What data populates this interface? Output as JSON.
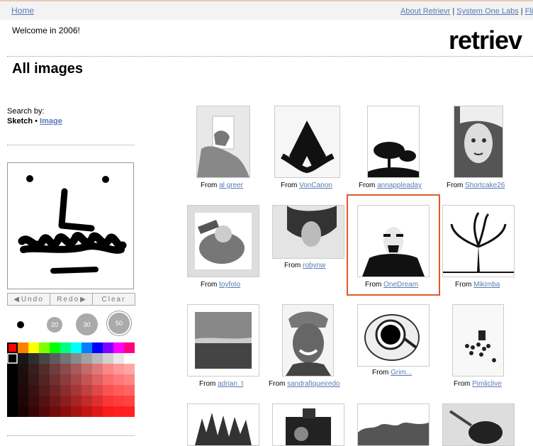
{
  "topbar": {
    "home": "Home",
    "about": "About Retrievr",
    "sep1": " | ",
    "system": "System One Labs",
    "sep2": " | ",
    "flickr": "Flic"
  },
  "welcome": "Welcome in 2006!",
  "logo": "retriev",
  "page_title": "All images",
  "search": {
    "label": "Search by:",
    "sketch": "Sketch",
    "dot": " • ",
    "image": "Image"
  },
  "toolbar": {
    "undo": "Undo",
    "redo": "Redo",
    "clear": "Clear"
  },
  "brushes": [
    "",
    "20",
    "30",
    "50"
  ],
  "results": [
    {
      "from": "From ",
      "user": "al greer"
    },
    {
      "from": "From ",
      "user": "VonCanon"
    },
    {
      "from": "From ",
      "user": "annappleaday"
    },
    {
      "from": "From ",
      "user": "Shortcake26"
    },
    {
      "from": "From ",
      "user": "toyfoto"
    },
    {
      "from": "From ",
      "user": "robynw"
    },
    {
      "from": "From ",
      "user": "OneDream"
    },
    {
      "from": "From ",
      "user": "Mikimba"
    },
    {
      "from": "From ",
      "user": "adrian_t"
    },
    {
      "from": "From ",
      "user": "sandrafiqueiredo"
    },
    {
      "from": "From ",
      "user": "Grim..."
    },
    {
      "from": "From ",
      "user": "Pimliclive"
    }
  ],
  "colors": {
    "link": "#5a7bb5",
    "highlight": "#e05a2a"
  }
}
